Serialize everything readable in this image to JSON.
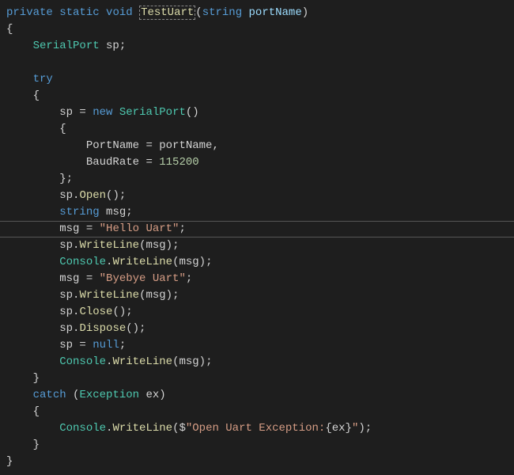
{
  "code": {
    "l0a": "private",
    "l0b": "static",
    "l0c": "void",
    "l0d": "TestUart",
    "l0e": "string",
    "l0f": "portName",
    "l0paren1": "(",
    "l0paren2": ")",
    "l0space": " ",
    "l1": "{",
    "l2type": "SerialPort",
    "l2var": " sp;",
    "l3kw": "try",
    "l4": "{",
    "l5a": "sp = ",
    "l5b": "new",
    "l5c": " ",
    "l5d": "SerialPort",
    "l5e": "()",
    "l6": "{",
    "l7a": "PortName = portName,",
    "l7label": "PortName",
    "l8a": "BaudRate = ",
    "l8b": "115200",
    "l8label": "BaudRate",
    "l9": "};",
    "l10": "sp.Open();",
    "l10m": "Open",
    "l11a": "string",
    "l11b": " msg;",
    "l12a": "msg = ",
    "l12b": "\"Hello Uart\"",
    "l12c": ";",
    "l13": "sp.WriteLine(msg);",
    "l13m": "WriteLine",
    "l14a": "Console",
    "l14b": ".WriteLine(msg);",
    "l14m": "WriteLine",
    "l15a": "msg = ",
    "l15b": "\"Byebye Uart\"",
    "l15c": ";",
    "l16": "sp.WriteLine(msg);",
    "l16m": "WriteLine",
    "l17": "sp.Close();",
    "l17m": "Close",
    "l18": "sp.Dispose();",
    "l18m": "Dispose",
    "l19a": "sp = ",
    "l19b": "null",
    "l19c": ";",
    "l20a": "Console",
    "l20b": ".WriteLine(msg);",
    "l20m": "WriteLine",
    "l21": "}",
    "l22a": "catch",
    "l22b": " (",
    "l22c": "Exception",
    "l22d": " ex)",
    "l23": "{",
    "l24a": "Console",
    "l24b": ".WriteLine($",
    "l24c": "\"Open Uart Exception:",
    "l24d": "{",
    "l24e": "ex",
    "l24f": "}",
    "l24g": "\"",
    "l24h": ");",
    "l24m": "WriteLine",
    "l25": "}",
    "l26": "}"
  },
  "indent": {
    "i1": "    ",
    "i2": "        ",
    "i3": "            "
  },
  "highlight_line_index": 13
}
